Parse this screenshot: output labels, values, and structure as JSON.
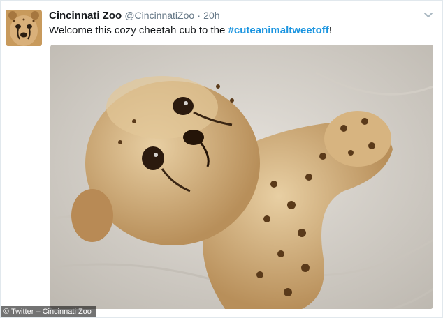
{
  "tweet": {
    "display_name": "Cincinnati Zoo",
    "handle": "@CincinnatiZoo",
    "separator": "·",
    "time": "20h",
    "text_prefix": "Welcome this cozy cheetah cub to the ",
    "hashtag": "#cuteanimaltweetoff",
    "text_suffix": "!",
    "avatar_icon": "cheetah-face-icon",
    "menu_icon": "chevron-down-icon"
  },
  "media": {
    "description_icon": "cheetah-cub-photo",
    "credit": "© Twitter – Cincinnati Zoo"
  },
  "colors": {
    "hashtag": "#1b95e0",
    "handle": "#657786",
    "name": "#14171a"
  }
}
